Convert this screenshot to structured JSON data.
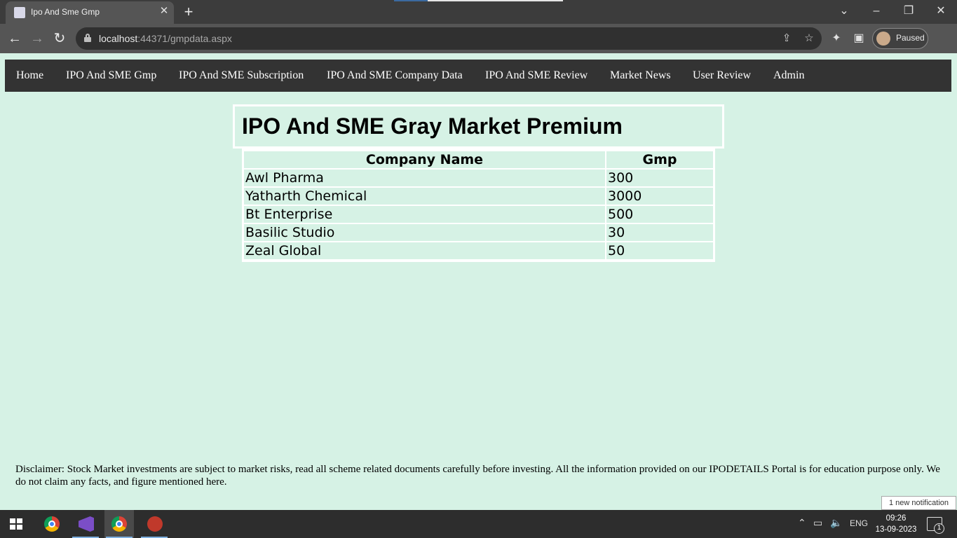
{
  "browser": {
    "tab_title": "Ipo And Sme Gmp",
    "url_host": "localhost",
    "url_rest": ":44371/gmpdata.aspx",
    "profile_label": "Paused"
  },
  "nav": {
    "items": [
      "Home",
      "IPO And SME Gmp",
      "IPO And SME Subscription",
      "IPO And SME Company Data",
      "IPO And SME Review",
      "Market News",
      "User Review",
      "Admin"
    ]
  },
  "page": {
    "title": "IPO And SME Gray Market Premium"
  },
  "table": {
    "headers": [
      "Company Name",
      "Gmp"
    ],
    "rows": [
      [
        "Awl Pharma",
        "300"
      ],
      [
        "Yatharth Chemical",
        "3000"
      ],
      [
        "Bt Enterprise",
        "500"
      ],
      [
        "Basilic Studio",
        "30"
      ],
      [
        "Zeal Global",
        "50"
      ]
    ]
  },
  "footer": {
    "disclaimer": "Disclaimer: Stock Market investments are subject to market risks, read all scheme related documents carefully before investing. All the information provided on our IPODETAILS Portal is for education purpose only. We do not claim any facts, and figure mentioned here."
  },
  "notification": {
    "text": "1 new notification"
  },
  "taskbar": {
    "language": "ENG",
    "time": "09:26",
    "date": "13-09-2023",
    "badge_count": "1"
  }
}
